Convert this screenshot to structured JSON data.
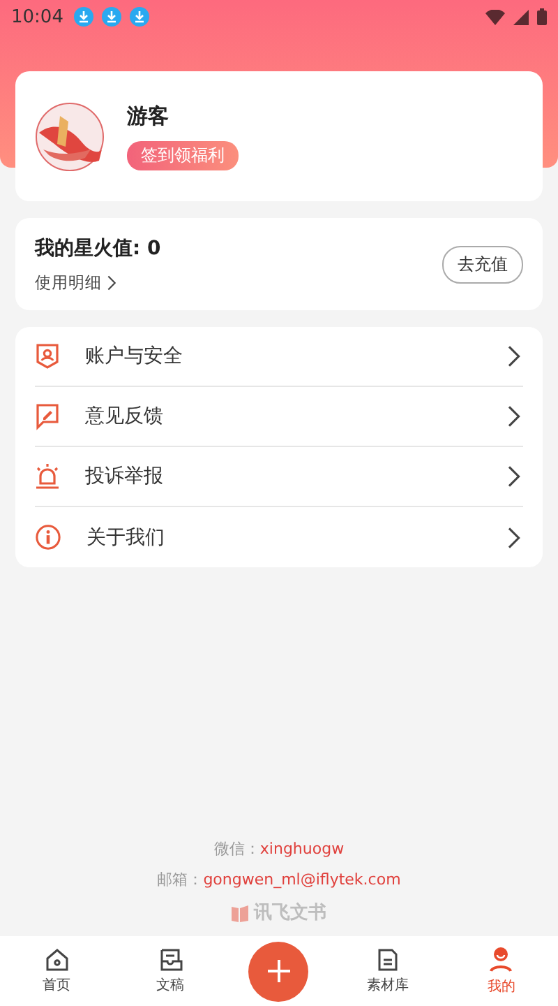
{
  "status_bar": {
    "time": "10:04",
    "notifications": [
      {
        "kind": "download"
      },
      {
        "kind": "download"
      },
      {
        "kind": "download"
      }
    ]
  },
  "profile": {
    "name": "游客",
    "badge": "签到领福利"
  },
  "points": {
    "title": "我的星火值: 0",
    "detail_link": "使用明细",
    "recharge_button": "去充值"
  },
  "menu": [
    {
      "kind": "account",
      "label": "账户与安全"
    },
    {
      "kind": "feedback",
      "label": "意见反馈"
    },
    {
      "kind": "report",
      "label": "投诉举报"
    },
    {
      "kind": "about",
      "label": "关于我们"
    }
  ],
  "contact": [
    {
      "label": "微信：",
      "value": "xinghuogw"
    },
    {
      "label": "邮箱：",
      "value": "gongwen_ml@iflytek.com"
    }
  ],
  "brand": "讯飞文书",
  "nav": [
    {
      "kind": "home",
      "label": "首页",
      "selected": false
    },
    {
      "kind": "drafts",
      "label": "文稿",
      "selected": false
    },
    {
      "kind": "add"
    },
    {
      "kind": "library",
      "label": "素材库",
      "selected": false
    },
    {
      "kind": "me",
      "label": "我的",
      "selected": true
    }
  ]
}
